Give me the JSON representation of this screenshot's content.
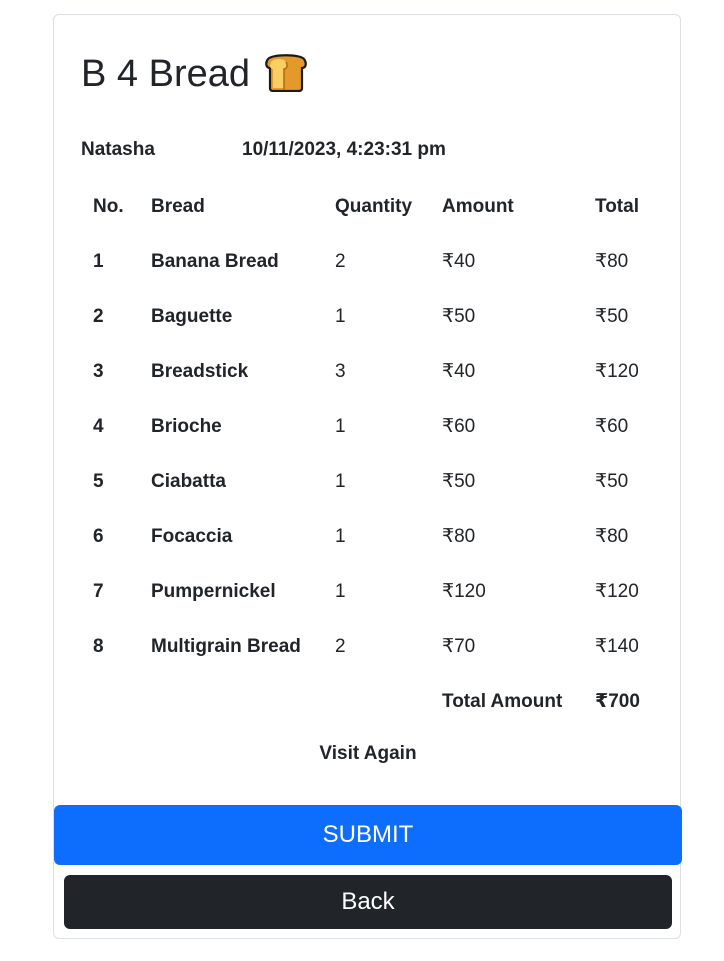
{
  "header": {
    "title": "B 4 Bread",
    "icon": "bread-icon"
  },
  "customer": {
    "name": "Natasha",
    "datetime": "10/11/2023, 4:23:31 pm"
  },
  "table": {
    "columns": [
      "No.",
      "Bread",
      "Quantity",
      "Amount",
      "Total"
    ],
    "rows": [
      {
        "no": "1",
        "bread": "Banana Bread",
        "quantity": "2",
        "amount": "₹40",
        "total": "₹80"
      },
      {
        "no": "2",
        "bread": "Baguette",
        "quantity": "1",
        "amount": "₹50",
        "total": "₹50"
      },
      {
        "no": "3",
        "bread": "Breadstick",
        "quantity": "3",
        "amount": "₹40",
        "total": "₹120"
      },
      {
        "no": "4",
        "bread": "Brioche",
        "quantity": "1",
        "amount": "₹60",
        "total": "₹60"
      },
      {
        "no": "5",
        "bread": "Ciabatta",
        "quantity": "1",
        "amount": "₹50",
        "total": "₹50"
      },
      {
        "no": "6",
        "bread": "Focaccia",
        "quantity": "1",
        "amount": "₹80",
        "total": "₹80"
      },
      {
        "no": "7",
        "bread": "Pumpernickel",
        "quantity": "1",
        "amount": "₹120",
        "total": "₹120"
      },
      {
        "no": "8",
        "bread": "Multigrain Bread",
        "quantity": "2",
        "amount": "₹70",
        "total": "₹140"
      }
    ],
    "total_label": "Total Amount",
    "total_value": "₹700"
  },
  "footer": {
    "message": "Visit Again",
    "submit_label": "SUBMIT",
    "back_label": "Back"
  },
  "colors": {
    "primary": "#0d6efd",
    "dark": "#212529",
    "bread_crust": "#c87a1e",
    "bread_face": "#f7c04a"
  }
}
